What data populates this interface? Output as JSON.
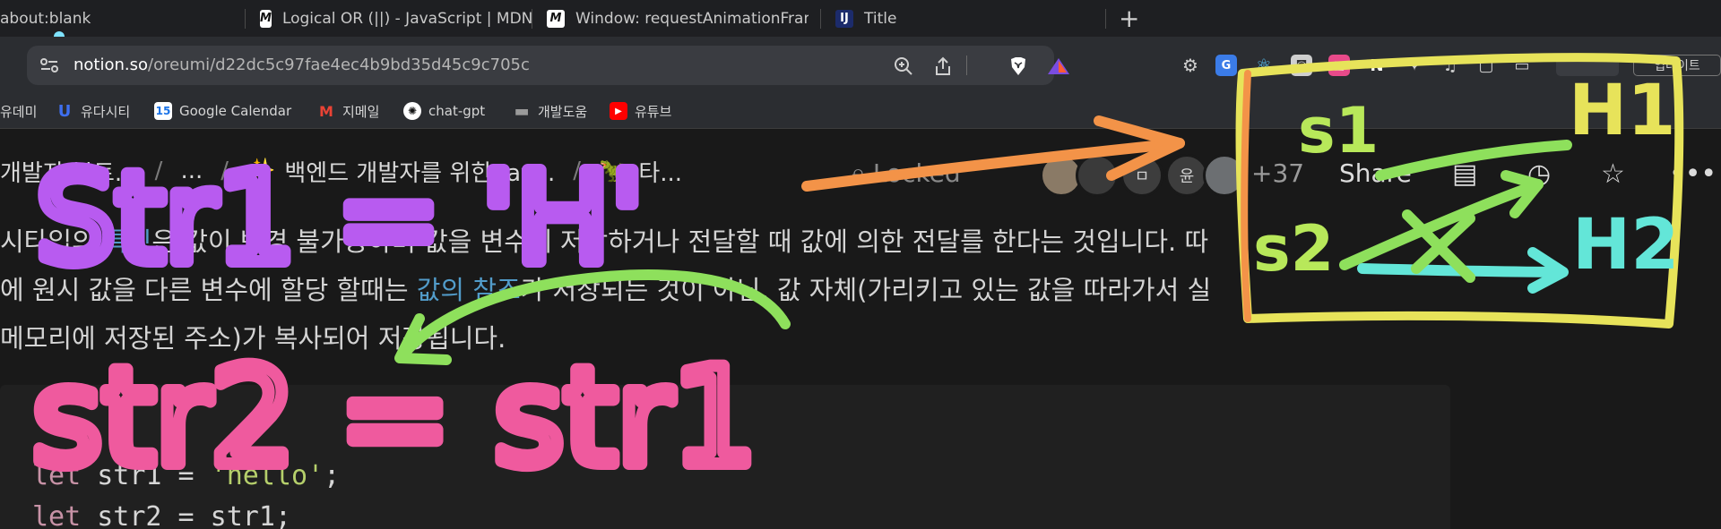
{
  "browser": {
    "tabs": [
      {
        "title": "about:blank",
        "icon": "none"
      },
      {
        "title": "Logical OR (||) - JavaScript | MDN",
        "icon": "mdn-icon"
      },
      {
        "title": "Window: requestAnimationFrame()",
        "icon": "mdn-icon"
      },
      {
        "title": "Title",
        "icon": "webstorm-icon"
      }
    ],
    "new_tab_label": "+",
    "url_host": "notion.so",
    "url_path": "/oreumi/d22dc5c97fae4ec4b9bd35d45c9c705c",
    "update_label": "업데이트"
  },
  "bookmarks": [
    {
      "label": "유데미",
      "icon": "udemy-icon"
    },
    {
      "label": "유다시티",
      "icon": "udacity-icon"
    },
    {
      "label": "Google Calendar",
      "icon": "calendar-icon"
    },
    {
      "label": "지메일",
      "icon": "gmail-icon"
    },
    {
      "label": "chat-gpt",
      "icon": "openai-icon"
    },
    {
      "label": "개발도움",
      "icon": "folder-icon"
    },
    {
      "label": "유튜브",
      "icon": "youtube-icon"
    }
  ],
  "notion": {
    "breadcrumbs": [
      {
        "label": "개발자 부트..."
      },
      {
        "label": "..."
      },
      {
        "label": "백엔드 개발자를 위한 Jav...",
        "emoji": "✨"
      },
      {
        "label": "타...",
        "emoji": "🦖"
      }
    ],
    "locked_label": "Locked",
    "avatar_initials": [
      "ㅁ",
      "윤"
    ],
    "member_count": "+37",
    "share_label": "Share",
    "paragraph": {
      "line1_a": "시타입의 ",
      "line1_hl": "특징",
      "line1_b": "은 값이 변경 불가능하며 값을 변수에 저장하거나 전달할 때 값에 의한 전달를 한다는 것입니다. 따",
      "line2_a": "에 원시 값을 다른 변수에 할당 할때는 ",
      "line2_hl": "값의 참조",
      "line2_b": "가 저장되는 것이 아닌, 값 자체(가리키고 있는 값을 따라가서 실",
      "line3": " 메모리에 저장된 주소)가 복사되어 저장됩니다."
    },
    "code": {
      "line1_kw": "let",
      "line1_var": " str1 = ",
      "line1_str": "'hello'",
      "line1_end": ";",
      "line2_kw": "let",
      "line2_rest": " str2 = str1;"
    }
  },
  "annotations": {
    "str1_eq": "Str1 = 'H'",
    "str2_eq": "str2 = str1",
    "box_s1": "s1",
    "box_s2": "s2",
    "box_h1": "H1",
    "box_h2": "H2",
    "colors": {
      "purple": "#b85bf0",
      "pink": "#ef5a9e",
      "red": "#ea5a5a",
      "orange": "#f39348",
      "green": "#8ee05c",
      "yellow": "#e7e35a",
      "cyan": "#63e6d8"
    }
  }
}
